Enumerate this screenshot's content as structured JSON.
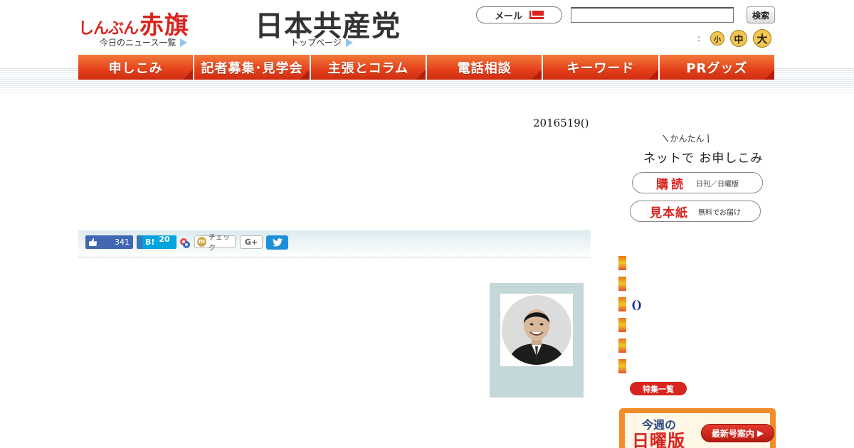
{
  "header": {
    "akahata_kana": "しんぶん",
    "akahata_kanji": "赤旗",
    "news_list_link": "今日のニュース一覧",
    "jcp_logo": "日本共産党",
    "top_page_link": "トップページ",
    "mail_label": "メール",
    "search_button": "検索",
    "font_size_colon": ":",
    "font_sizes": [
      "小",
      "中",
      "大"
    ]
  },
  "nav": {
    "items": [
      "申しこみ",
      "記者募集･見学会",
      "主張とコラム",
      "電話相談",
      "キーワード",
      "PRグッズ"
    ]
  },
  "article": {
    "date": "2016519()"
  },
  "share": {
    "fb_count": "341",
    "hatena_label": "B!",
    "hatena_count": "20",
    "mixi_label": "チェック",
    "gplus_label": "G+",
    "mixi_letter": "m"
  },
  "sidebar": {
    "easy_label": "かんたん",
    "net_apply": "ネットで お申しこみ",
    "subscribe_big": "購読",
    "subscribe_small": "日刊／日曜版",
    "sample_big": "見本紙",
    "sample_small": "無料でお届け",
    "paren_text": "()",
    "tokushu_button": "特集一覧",
    "sunday_week": "今週の",
    "sunday_title": "日曜版",
    "latest_button": "最新号案内"
  },
  "colors": {
    "brand_red": "#d8241e",
    "nav_orange": "#e4401a",
    "facebook": "#4267b2",
    "twitter": "#1d8fd8"
  },
  "icons": [
    "mail-icon",
    "thumb-up-icon",
    "twitter-bird-icon",
    "google-icon",
    "triangle-arrow-icon"
  ]
}
